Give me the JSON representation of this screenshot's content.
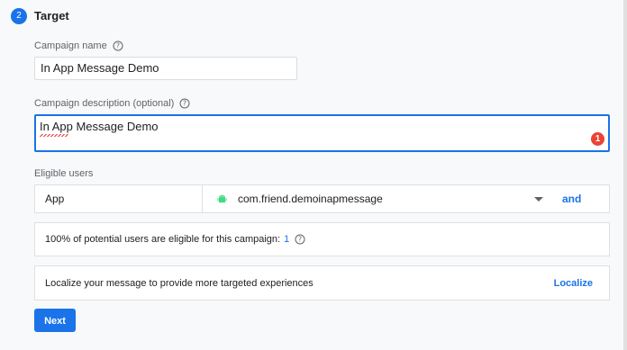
{
  "section": {
    "step_number": "2",
    "title": "Target"
  },
  "campaign_name": {
    "label": "Campaign name",
    "value": "In App Message Demo"
  },
  "campaign_description": {
    "label": "Campaign description (optional)",
    "value": "In App Message Demo",
    "error_count": "1"
  },
  "eligible_users": {
    "label": "Eligible users",
    "app_label": "App",
    "app_value": "com.friend.demoinapmessage",
    "and_label": "and"
  },
  "potential_users": {
    "text": "100% of potential users are eligible for this campaign:",
    "count": "1"
  },
  "localize": {
    "text": "Localize your message to provide more targeted experiences",
    "link_label": "Localize"
  },
  "next_button": {
    "label": "Next"
  },
  "colors": {
    "accent": "#1a73e8",
    "error": "#ea4335",
    "android": "#3ddc84"
  },
  "icons": {
    "help": "help-circle-icon",
    "android": "android-icon",
    "dropdown": "chevron-down-icon"
  }
}
